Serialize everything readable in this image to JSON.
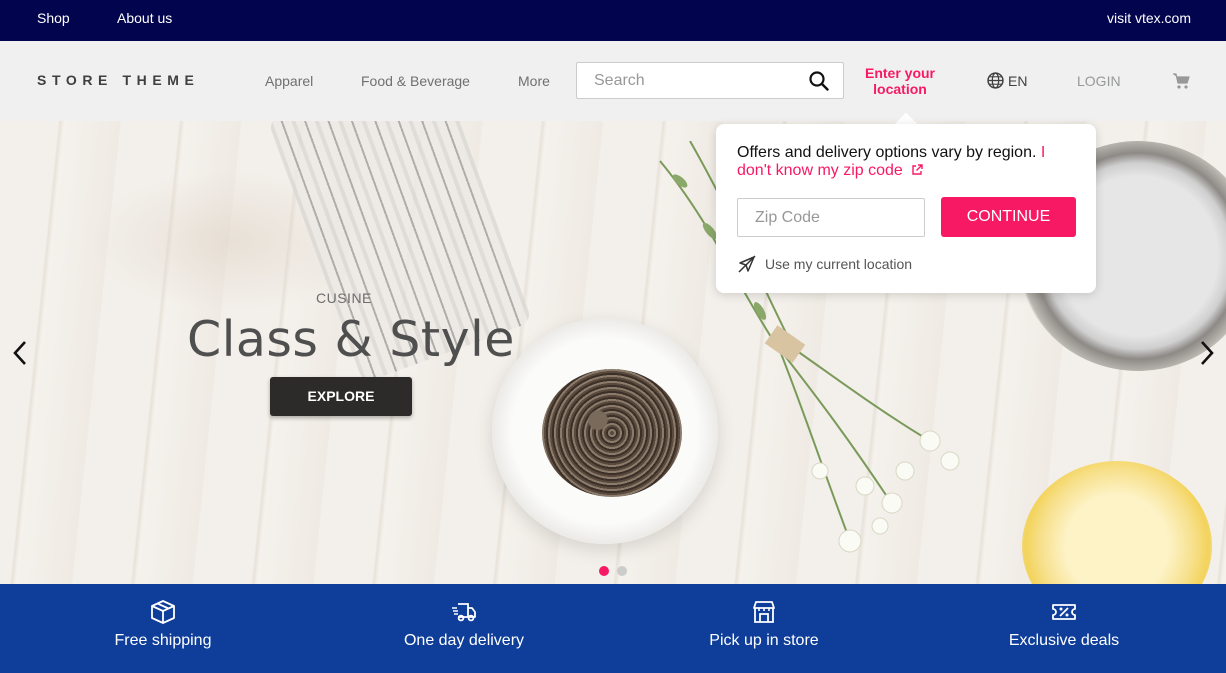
{
  "topbar": {
    "shop_label": "Shop",
    "about_label": "About us",
    "visit_label": "visit vtex.com"
  },
  "header": {
    "logo": "STORE THEME",
    "nav": [
      "Apparel",
      "Food & Beverage",
      "More"
    ],
    "search_placeholder": "Search",
    "location_line1": "Enter your",
    "location_line2": "location",
    "language": "EN",
    "login_label": "LOGIN",
    "icons": [
      "search-icon",
      "globe-icon",
      "cart-icon"
    ]
  },
  "hero": {
    "kicker": "CUSINE",
    "title": "Class & Style",
    "button_label": "EXPLORE",
    "slide_count": 2,
    "active_slide": 1,
    "icons": [
      "chevron-left-icon",
      "chevron-right-icon"
    ]
  },
  "popover": {
    "message": "Offers and delivery options vary by region. ",
    "link_label": "I don't know my zip code",
    "zip_placeholder": "Zip Code",
    "continue_label": "CONTINUE",
    "use_location_label": "Use my current location",
    "icons": [
      "external-link-icon",
      "location-off-icon"
    ]
  },
  "benefits": [
    {
      "label": "Free shipping",
      "icon": "box-icon"
    },
    {
      "label": "One day delivery",
      "icon": "truck-icon"
    },
    {
      "label": "Pick up in store",
      "icon": "store-icon"
    },
    {
      "label": "Exclusive deals",
      "icon": "coupon-icon"
    }
  ],
  "colors": {
    "topbar_bg": "#03044e",
    "header_bg": "#f0f0f0",
    "accent": "#f71963",
    "benefits_bg": "#0e3e99"
  }
}
